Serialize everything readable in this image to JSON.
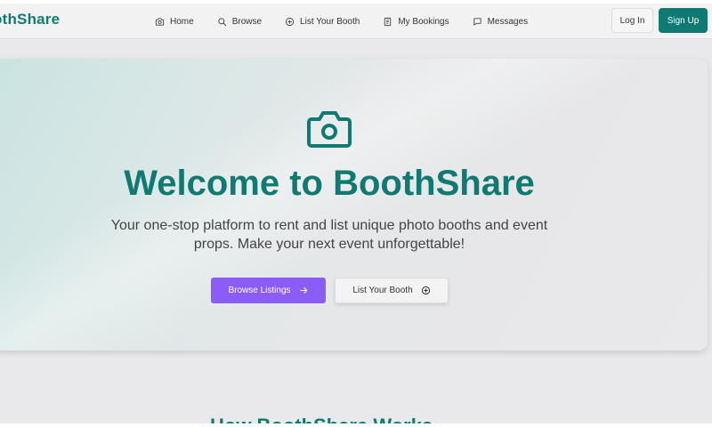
{
  "brand": {
    "name": "othShare"
  },
  "nav": {
    "items": [
      {
        "label": "Home",
        "icon": "camera-icon"
      },
      {
        "label": "Browse",
        "icon": "search-icon"
      },
      {
        "label": "List Your Booth",
        "icon": "plus-circle-icon"
      },
      {
        "label": "My Bookings",
        "icon": "bookings-icon"
      },
      {
        "label": "Messages",
        "icon": "message-icon"
      }
    ]
  },
  "auth": {
    "login_label": "Log In",
    "signup_label": "Sign Up"
  },
  "hero": {
    "icon": "camera-icon",
    "title": "Welcome to BoothShare",
    "subtitle": "Your one-stop platform to rent and list unique photo booths and event props. Make your next event unforgettable!",
    "primary_cta": "Browse Listings",
    "secondary_cta": "List Your Booth"
  },
  "section": {
    "heading": "How BoothShare Works"
  },
  "colors": {
    "brand": "#0f7a72",
    "accent": "#8b5cf6",
    "background": "#e9e9eb"
  }
}
